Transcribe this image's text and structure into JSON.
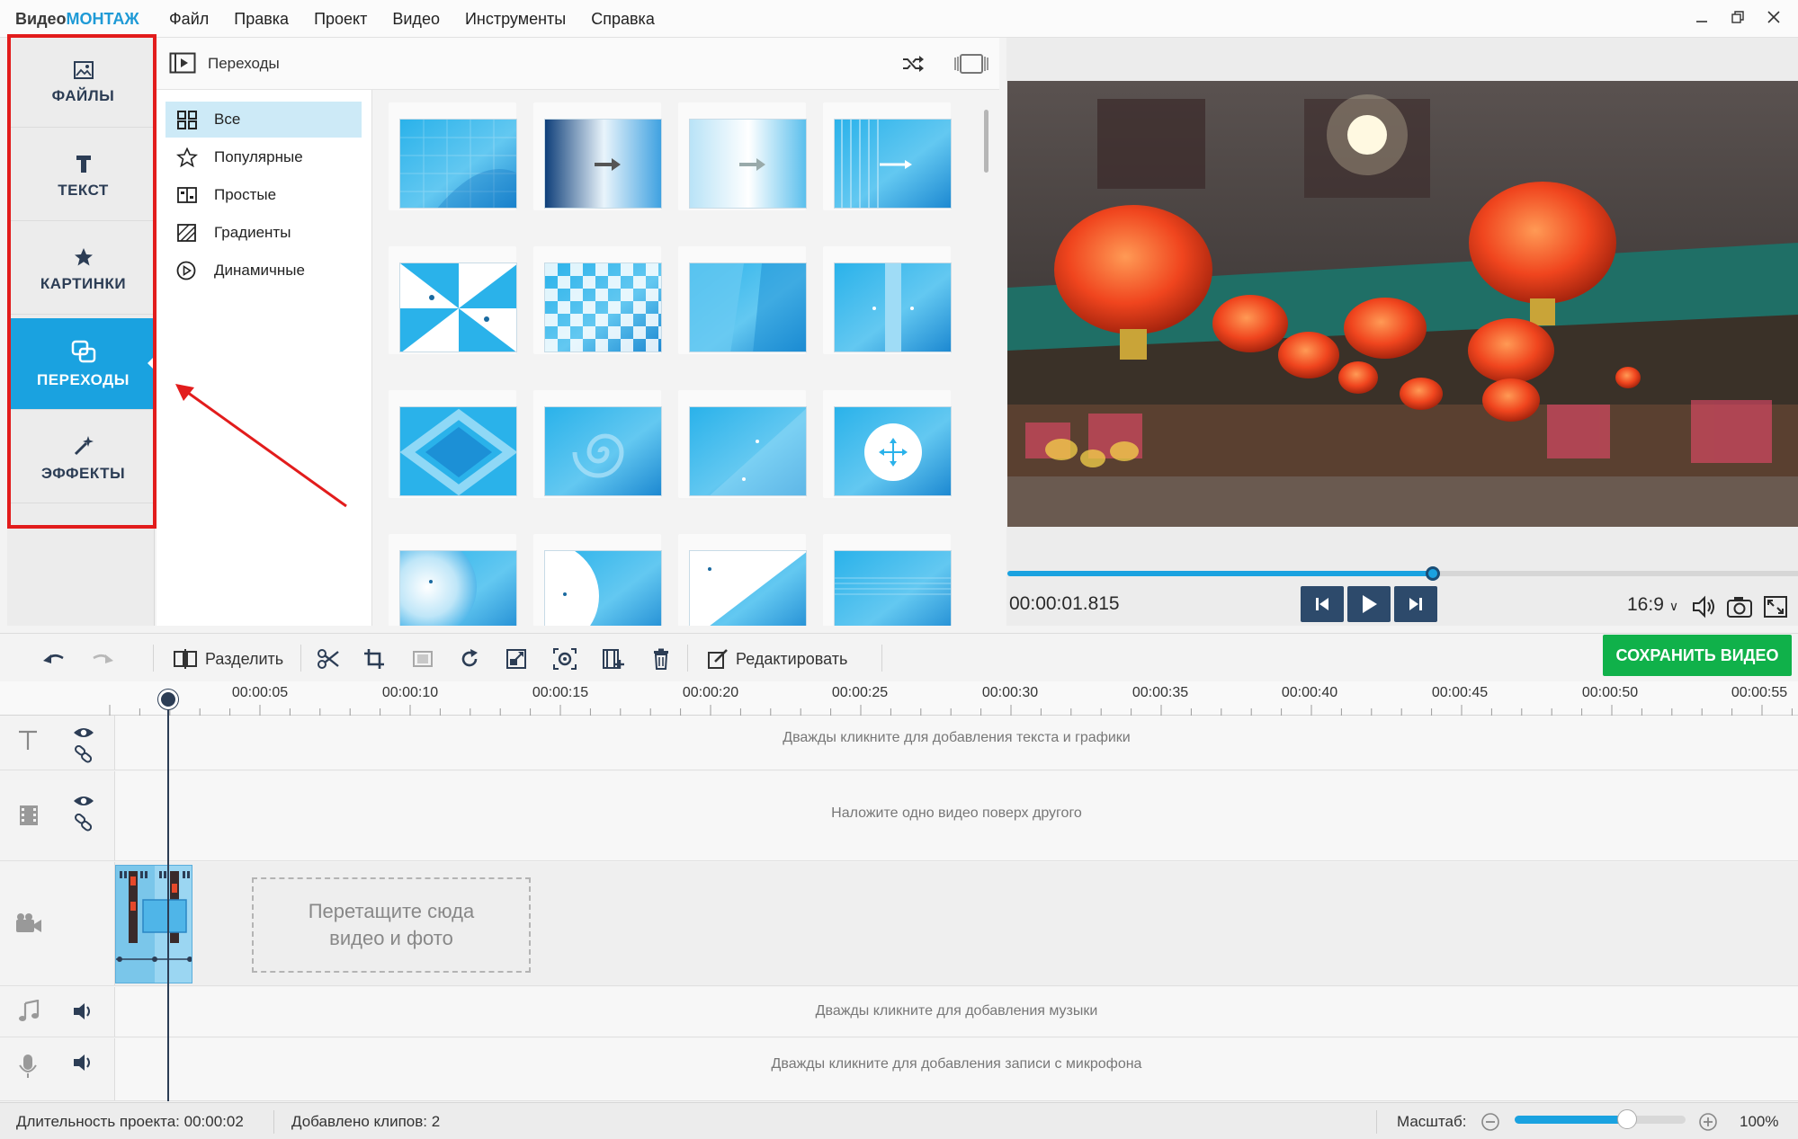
{
  "app": {
    "logo_part1": "Видео",
    "logo_part2": "МОНТАЖ"
  },
  "menu": [
    "Файл",
    "Правка",
    "Проект",
    "Видео",
    "Инструменты",
    "Справка"
  ],
  "left_tabs": [
    {
      "label": "ФАЙЛЫ",
      "icon": "image-icon",
      "active": false
    },
    {
      "label": "ТЕКСТ",
      "icon": "text-t-icon",
      "active": false
    },
    {
      "label": "КАРТИНКИ",
      "icon": "star-icon",
      "active": false
    },
    {
      "label": "ПЕРЕХОДЫ",
      "icon": "transitions-icon",
      "active": true
    },
    {
      "label": "ЭФФЕКТЫ",
      "icon": "magic-wand-icon",
      "active": false
    }
  ],
  "panel": {
    "title": "Переходы",
    "categories": [
      {
        "label": "Все",
        "icon": "grid-icon",
        "active": true
      },
      {
        "label": "Популярные",
        "icon": "star-outline-icon",
        "active": false
      },
      {
        "label": "Простые",
        "icon": "simple-icon",
        "active": false
      },
      {
        "label": "Градиенты",
        "icon": "gradient-icon",
        "active": false
      },
      {
        "label": "Динамичные",
        "icon": "play-circle-icon",
        "active": false
      }
    ]
  },
  "player": {
    "timecode": "00:00:01.815",
    "progress_fraction": 0.539,
    "aspect": "16:9"
  },
  "toolbar": {
    "split_label": "Разделить",
    "edit_label": "Редактировать",
    "save_label": "СОХРАНИТЬ ВИДЕО"
  },
  "timeline": {
    "ruler": [
      "00:00:05",
      "00:00:10",
      "00:00:15",
      "00:00:20",
      "00:00:25",
      "00:00:30",
      "00:00:35",
      "00:00:40",
      "00:00:45",
      "00:00:50",
      "00:00:55"
    ],
    "text_hint": "Дважды кликните для добавления текста и графики",
    "overlay_hint": "Наложите одно видео поверх другого",
    "drop_line1": "Перетащите сюда",
    "drop_line2": "видео и фото",
    "music_hint": "Дважды кликните для добавления музыки",
    "mic_hint": "Дважды кликните для добавления записи с микрофона"
  },
  "status": {
    "duration_label": "Длительность проекта:",
    "duration_value": "00:00:02",
    "clips_label": "Добавлено клипов:",
    "clips_value": "2",
    "zoom_label": "Масштаб:",
    "zoom_value": "100%",
    "zoom_fraction": 0.66
  },
  "colors": {
    "accent": "#1aa2e0",
    "save_green": "#10b14a",
    "annotation_red": "#e21c1c",
    "navy": "#2c3d55"
  }
}
